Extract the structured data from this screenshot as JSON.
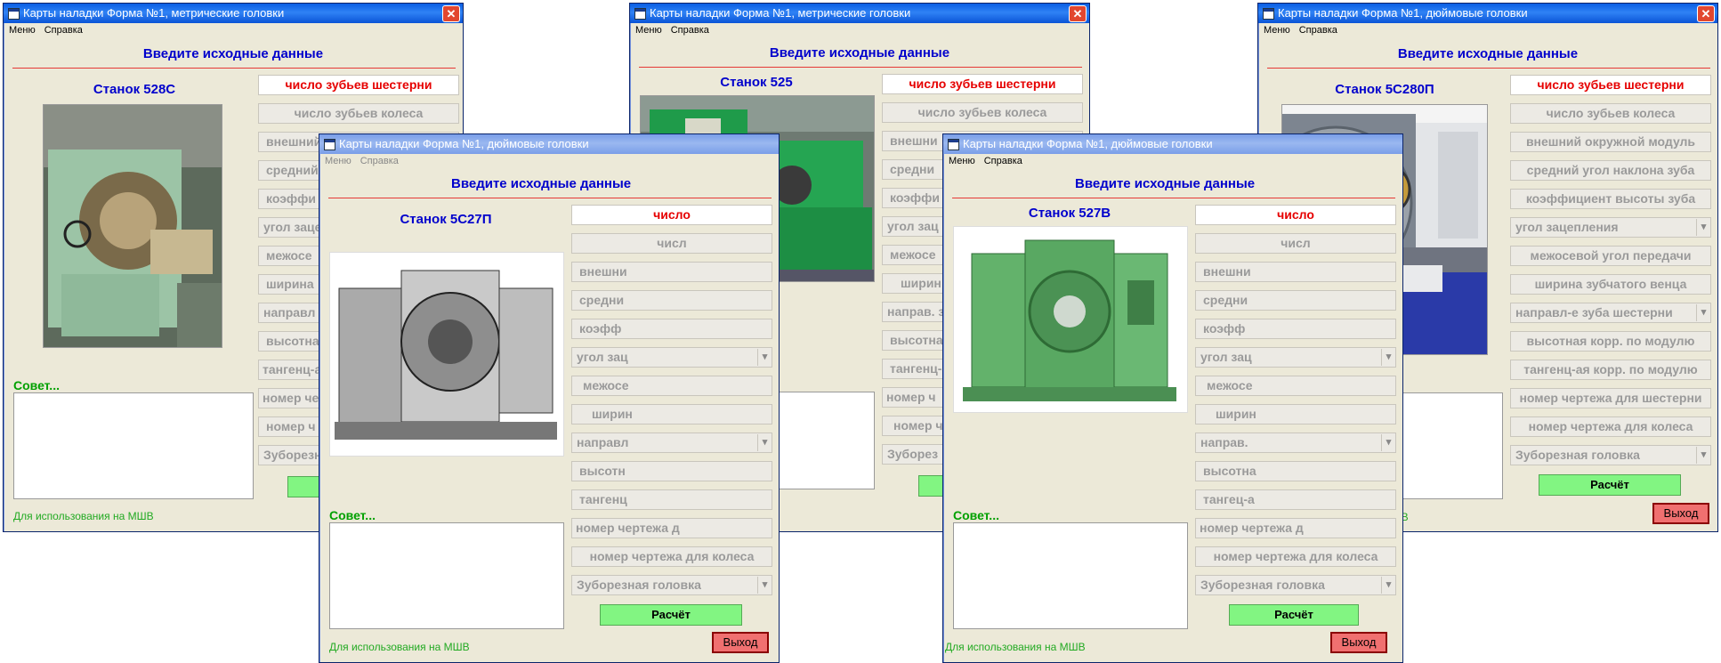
{
  "common": {
    "menu_label": "Меню",
    "help_label": "Справка",
    "heading": "Введите исходные данные",
    "advice": "Совет...",
    "calc_label": "Расчёт",
    "exit_label": "Выход",
    "note": "Для использования на МШВ",
    "close_glyph": "✕"
  },
  "windows": {
    "w1": {
      "title": "Карты наладки Форма №1, метрические головки",
      "machine": "Станок 528С",
      "fields": [
        "число зубьев шестерни",
        "число зубьев колеса",
        "внешний",
        "средний",
        "коэффи",
        "угол зацеп",
        "межосе",
        "ширина",
        "направл",
        "высотна",
        "тангенц-а",
        "номер черте",
        "номер ч",
        "Зуборезна"
      ]
    },
    "w2": {
      "title": "Карты наладки Форма №1, дюймовые головки",
      "machine": "Станок 5С27П",
      "fields": [
        "число",
        "числ",
        "внешни",
        "средни",
        "коэфф",
        "угол зац",
        "межосе",
        "ширин",
        "направл",
        "высотн",
        "тангенц",
        "номер чертежа д",
        "номер чертежа для колеса",
        "Зуборезная головка"
      ]
    },
    "w3": {
      "title": "Карты наладки Форма №1, метрические головки",
      "machine": "Станок 525",
      "fields": [
        "число зубьев шестерни",
        "число зубьев колеса",
        "внешни",
        "средни",
        "коэффи",
        "угол зац",
        "межосе",
        "ширин",
        "направ. з",
        "высотна",
        "тангенц-а",
        "номер ч",
        "номер ч",
        "Зуборез"
      ]
    },
    "w4": {
      "title": "Карты наладки Форма №1, дюймовые головки",
      "machine": "Станок 527В",
      "fields": [
        "число",
        "числ",
        "внешни",
        "средни",
        "коэфф",
        "угол зац",
        "межосе",
        "ширин",
        "направ.",
        "высотна",
        "тангец-а",
        "номер чертежа д",
        "номер чертежа для колеса",
        "Зуборезная головка"
      ]
    },
    "w5": {
      "title": "Карты наладки Форма №1, дюймовые головки",
      "machine": "Станок 5С280П",
      "fields": [
        "число зубьев шестерни",
        "число зубьев колеса",
        "внешний окружной модуль",
        "средний угол наклона зуба",
        "коэффициент высоты зуба",
        "угол зацепления",
        "межосевой угол передачи",
        "ширина зубчатого венца",
        "направл-е зуба шестерни",
        "высотная корр. по модулю",
        "тангенц-ая корр. по модулю",
        "номер чертежа для шестерни",
        "номер чертежа для колеса",
        "Зуборезная головка"
      ]
    }
  }
}
